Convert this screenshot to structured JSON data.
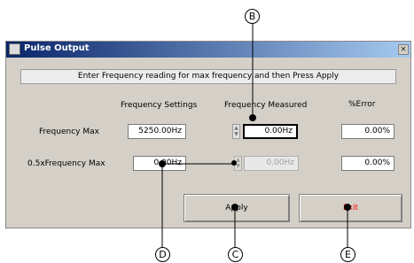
{
  "window": {
    "title": "Pulse Output",
    "close_symbol": "×",
    "instruction": "Enter Frequency reading for max frequency and then Press Apply"
  },
  "columns": {
    "settings": "Frequency Settings",
    "measured": "Frequency Measured",
    "error": "%Error"
  },
  "rows": [
    {
      "label": "Frequency Max",
      "setting": "5250.00Hz",
      "measured": "0.00Hz",
      "error": "0.00%"
    },
    {
      "label": "0.5xFrequency Max",
      "setting": "0.00Hz",
      "measured": "0.00Hz",
      "error": "0.00%"
    }
  ],
  "buttons": {
    "apply": "Apply",
    "exit": "Exit"
  },
  "callouts": {
    "b": "B",
    "c": "C",
    "d": "D",
    "e": "E"
  },
  "colors": {
    "title_bar": "#0a246a",
    "exit_text": "#ff0000"
  },
  "icons": {
    "window": "window-icon",
    "close": "close-icon"
  }
}
